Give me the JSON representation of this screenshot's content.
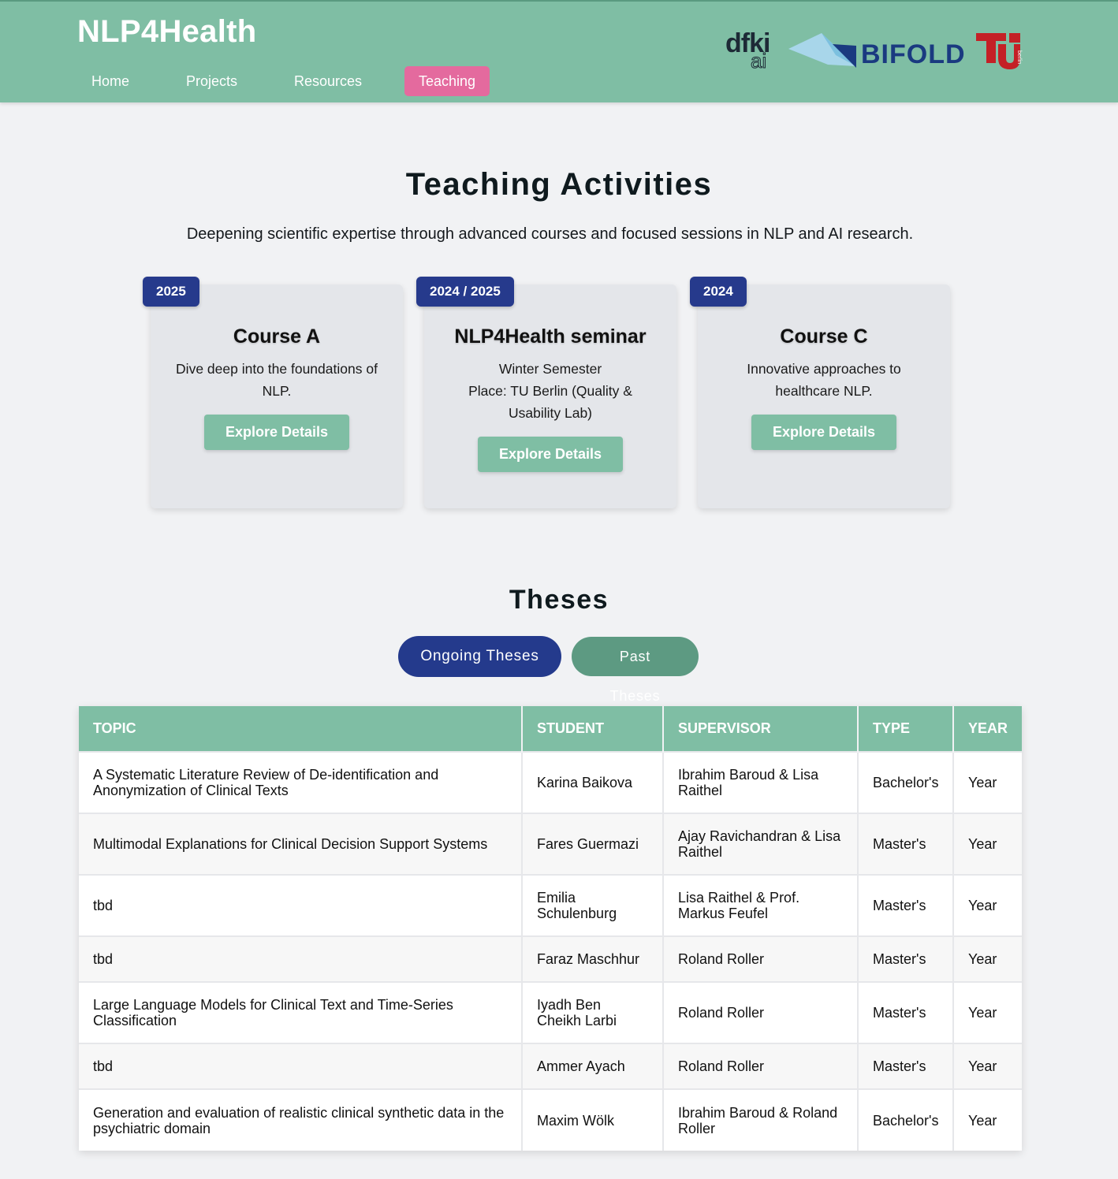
{
  "header": {
    "brand": "NLP4Health",
    "nav": [
      {
        "label": "Home"
      },
      {
        "label": "Projects"
      },
      {
        "label": "Resources"
      },
      {
        "label": "Teaching"
      }
    ],
    "active_color": "#e46a9e",
    "logos": {
      "dfki_top": "dfki",
      "dfki_bottom": "ai",
      "bifold": "BIFOLD",
      "tu": "TU berlin"
    }
  },
  "teaching": {
    "title": "Teaching Activities",
    "lead": "Deepening scientific expertise through advanced courses and focused sessions in NLP and AI research.",
    "courses": [
      {
        "badge": "2025",
        "title": "Course A",
        "desc": "Dive deep into the foundations of NLP.",
        "button": "Explore Details"
      },
      {
        "badge": "2024 / 2025",
        "title": "NLP4Health seminar",
        "desc": "Winter Semester\nPlace: TU Berlin (Quality & Usability Lab)",
        "button": "Explore Details"
      },
      {
        "badge": "2024",
        "title": "Course C",
        "desc": "Innovative approaches to healthcare NLP.",
        "button": "Explore Details"
      }
    ]
  },
  "theses": {
    "title": "Theses",
    "tab_ongoing": "Ongoing Theses",
    "tab_past": "Past Theses",
    "columns": [
      "Topic",
      "Student",
      "Supervisor",
      "Type",
      "Year"
    ],
    "rows": [
      {
        "topic": "A Systematic Literature Review of De-identification and Anonymization of Clinical Texts",
        "student": "Karina Baikova",
        "supervisor": "Ibrahim Baroud & Lisa Raithel",
        "type": "Bachelor's",
        "year": "Year"
      },
      {
        "topic": "Multimodal Explanations for Clinical Decision Support Systems",
        "student": "Fares Guermazi",
        "supervisor": "Ajay Ravichandran & Lisa Raithel",
        "type": "Master's",
        "year": "Year"
      },
      {
        "topic": "tbd",
        "student": "Emilia Schulenburg",
        "supervisor": "Lisa Raithel & Prof. Markus Feufel",
        "type": "Master's",
        "year": "Year"
      },
      {
        "topic": "tbd",
        "student": "Faraz Maschhur",
        "supervisor": "Roland Roller",
        "type": "Master's",
        "year": "Year"
      },
      {
        "topic": "Large Language Models for Clinical Text and Time-Series Classification",
        "student": "Iyadh Ben Cheikh Larbi",
        "supervisor": "Roland Roller",
        "type": "Master's",
        "year": "Year"
      },
      {
        "topic": "tbd",
        "student": "Ammer Ayach",
        "supervisor": "Roland Roller",
        "type": "Master's",
        "year": "Year"
      },
      {
        "topic": "Generation and evaluation of realistic clinical synthetic data in the psychiatric domain",
        "student": "Maxim Wölk",
        "supervisor": "Ibrahim Baroud & Roland Roller",
        "type": "Bachelor's",
        "year": "Year"
      }
    ]
  }
}
